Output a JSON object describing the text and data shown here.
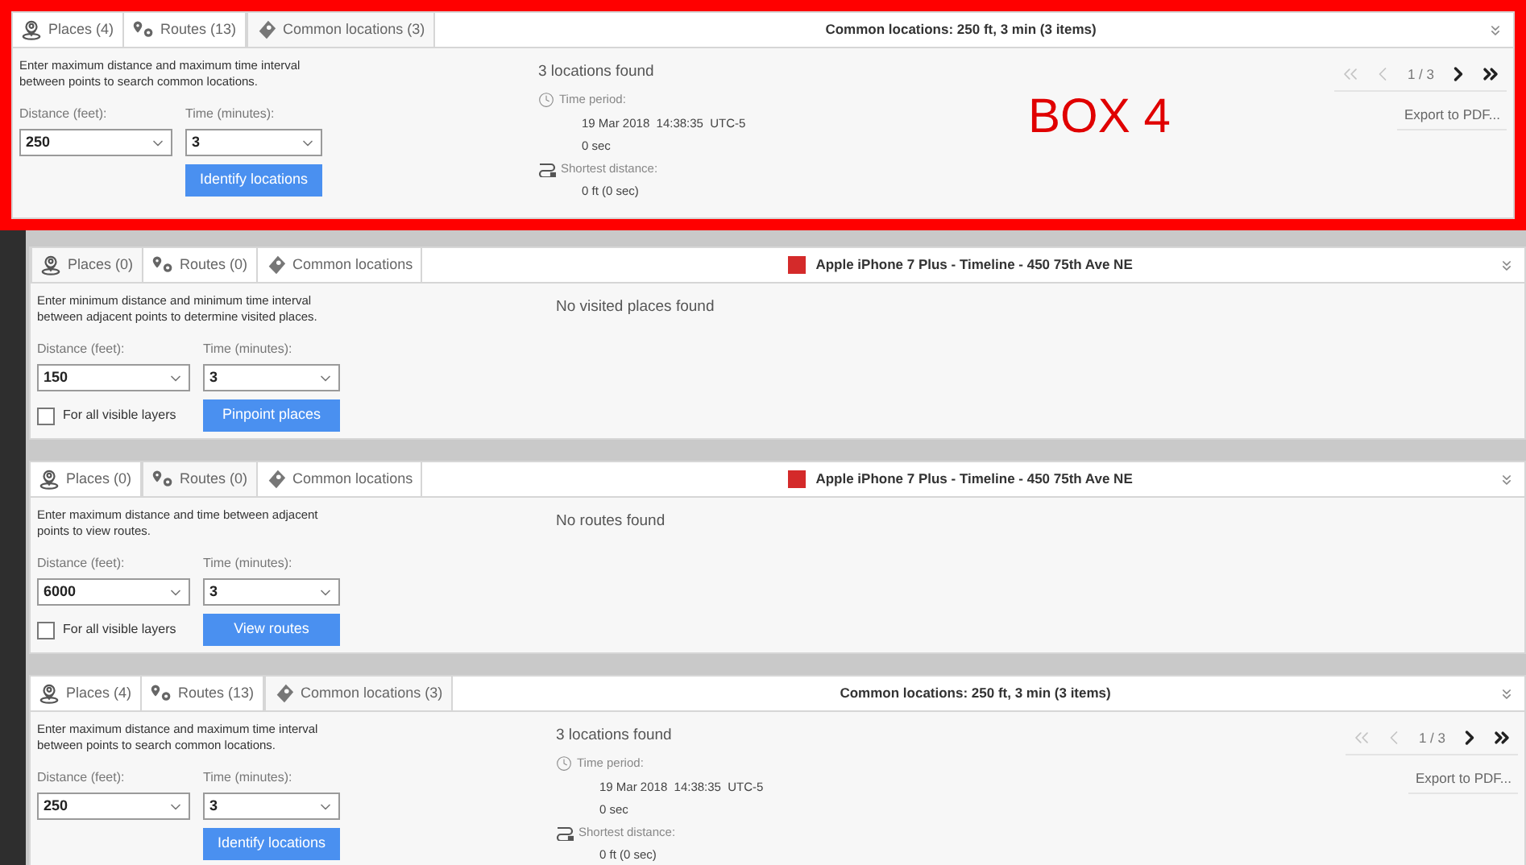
{
  "panels": [
    {
      "highlighted": true,
      "annotation": "BOX 4",
      "tabs": [
        {
          "label": "Places (4)",
          "selected": false
        },
        {
          "label": "Routes (13)",
          "selected": false
        },
        {
          "label": "Common locations (3)",
          "selected": true
        }
      ],
      "title": {
        "text": "Common locations: 250 ft, 3 min (3 items)"
      },
      "description": [
        "Enter maximum distance and maximum time interval",
        "between points to search common locations."
      ],
      "distance": {
        "label": "Distance (feet):",
        "value": "250"
      },
      "time": {
        "label": "Time (minutes):",
        "value": "3"
      },
      "button": "Identify locations",
      "result": {
        "kind": "locations",
        "heading": "3 locations found",
        "time_label": "Time period:",
        "time_value": "19 Mar 2018  14:38:35  UTC-5",
        "duration": "0 sec",
        "distance_label": "Shortest distance:",
        "distance_value": "0 ft (0 sec)"
      },
      "pager": {
        "first": {
          "disabled": true
        },
        "prev": {
          "disabled": true
        },
        "page": "1 / 3",
        "next": {
          "disabled": false
        },
        "last": {
          "disabled": false
        }
      },
      "export": "Export to PDF..."
    },
    {
      "highlighted": false,
      "tabs": [
        {
          "label": "Places (0)",
          "selected": true
        },
        {
          "label": "Routes (0)",
          "selected": false
        },
        {
          "label": "Common locations",
          "selected": false
        }
      ],
      "title": {
        "text": "Apple iPhone 7 Plus - Timeline - 450 75th Ave NE",
        "color": "#d42a2a"
      },
      "description": [
        "Enter minimum distance and minimum time interval",
        "between adjacent points to determine visited places."
      ],
      "distance": {
        "label": "Distance (feet):",
        "value": "150"
      },
      "time": {
        "label": "Time (minutes):",
        "value": "3"
      },
      "all_layers": {
        "label": "For all visible layers",
        "checked": false
      },
      "button": "Pinpoint places",
      "result": {
        "kind": "empty",
        "heading": "No visited places found"
      }
    },
    {
      "highlighted": false,
      "tabs": [
        {
          "label": "Places (0)",
          "selected": false
        },
        {
          "label": "Routes (0)",
          "selected": true
        },
        {
          "label": "Common locations",
          "selected": false
        }
      ],
      "title": {
        "text": "Apple iPhone 7 Plus - Timeline - 450 75th Ave NE",
        "color": "#d42a2a"
      },
      "description": [
        "Enter maximum distance and time between adjacent",
        "points to view routes."
      ],
      "distance": {
        "label": "Distance (feet):",
        "value": "6000"
      },
      "time": {
        "label": "Time (minutes):",
        "value": "3"
      },
      "all_layers": {
        "label": "For all visible layers",
        "checked": false
      },
      "button": "View routes",
      "result": {
        "kind": "empty",
        "heading": "No routes found"
      }
    },
    {
      "highlighted": false,
      "tabs": [
        {
          "label": "Places (4)",
          "selected": false
        },
        {
          "label": "Routes (13)",
          "selected": false
        },
        {
          "label": "Common locations (3)",
          "selected": true
        }
      ],
      "title": {
        "text": "Common locations: 250 ft, 3 min (3 items)"
      },
      "description": [
        "Enter maximum distance and maximum time interval",
        "between points to search common locations."
      ],
      "distance": {
        "label": "Distance (feet):",
        "value": "250"
      },
      "time": {
        "label": "Time (minutes):",
        "value": "3"
      },
      "button": "Identify locations",
      "result": {
        "kind": "locations",
        "heading": "3 locations found",
        "time_label": "Time period:",
        "time_value": "19 Mar 2018  14:38:35  UTC-5",
        "duration": "0 sec",
        "distance_label": "Shortest distance:",
        "distance_value": "0 ft (0 sec)"
      },
      "pager": {
        "first": {
          "disabled": true
        },
        "prev": {
          "disabled": true
        },
        "page": "1 / 3",
        "next": {
          "disabled": false
        },
        "last": {
          "disabled": false
        }
      },
      "export": "Export to PDF..."
    }
  ]
}
